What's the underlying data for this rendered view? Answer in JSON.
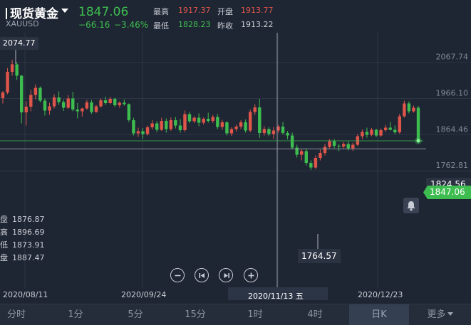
{
  "header": {
    "title": "现货黄金",
    "symbol": "XAUUSD",
    "price": "1847.06",
    "change": "−66.16",
    "change_pct": "−3.46%",
    "stats": {
      "high_label": "最高",
      "high": "1917.37",
      "open_label": "开盘",
      "open": "1913.77",
      "low_label": "最低",
      "low": "1828.23",
      "prev_label": "昨收",
      "prev": "1913.22"
    }
  },
  "chart_data": {
    "type": "candlestick",
    "y_ticks": [
      "2067.74",
      "1966.10",
      "1864.46",
      "1762.81"
    ],
    "x_ticks": [
      "2020/08/11",
      "2020/09/24",
      "2020/12/23"
    ],
    "crosshair_date": "2020/11/13 五",
    "crosshair_value": "1824.56",
    "current_price_tag": "1847.06",
    "max_marker": "2074.77",
    "min_marker": "1764.57",
    "ohlc_panel": [
      {
        "label": "盘",
        "value": "1876.87"
      },
      {
        "label": "高",
        "value": "1896.69"
      },
      {
        "label": "低",
        "value": "1873.91"
      },
      {
        "label": "盘",
        "value": "1887.47"
      }
    ],
    "candles": [
      [
        1967,
        1987,
        1952,
        1983
      ],
      [
        1983,
        2052,
        1978,
        2041
      ],
      [
        2041,
        2075,
        2030,
        2062
      ],
      [
        2062,
        2068,
        2018,
        2030
      ],
      [
        2030,
        2032,
        1896,
        1927
      ],
      [
        1927,
        1958,
        1890,
        1943
      ],
      [
        1943,
        1990,
        1930,
        1976
      ],
      [
        1976,
        2006,
        1964,
        1996
      ],
      [
        1996,
        2000,
        1955,
        1960
      ],
      [
        1960,
        1966,
        1918,
        1932
      ],
      [
        1932,
        1954,
        1920,
        1944
      ],
      [
        1944,
        1978,
        1938,
        1969
      ],
      [
        1969,
        1986,
        1948,
        1956
      ],
      [
        1956,
        1963,
        1931,
        1940
      ],
      [
        1940,
        1975,
        1936,
        1966
      ],
      [
        1966,
        1985,
        1930,
        1935
      ],
      [
        1935,
        1953,
        1910,
        1930
      ],
      [
        1930,
        1940,
        1915,
        1938
      ],
      [
        1938,
        1962,
        1934,
        1955
      ],
      [
        1955,
        1962,
        1923,
        1928
      ],
      [
        1928,
        1948,
        1926,
        1944
      ],
      [
        1944,
        1966,
        1940,
        1961
      ],
      [
        1961,
        1971,
        1948,
        1953
      ],
      [
        1953,
        1970,
        1950,
        1965
      ],
      [
        1965,
        1968,
        1942,
        1947
      ],
      [
        1947,
        1958,
        1940,
        1954
      ],
      [
        1954,
        1963,
        1946,
        1950
      ],
      [
        1950,
        1952,
        1900,
        1905
      ],
      [
        1905,
        1912,
        1862,
        1868
      ],
      [
        1868,
        1884,
        1858,
        1874
      ],
      [
        1874,
        1883,
        1853,
        1866
      ],
      [
        1866,
        1890,
        1862,
        1885
      ],
      [
        1885,
        1905,
        1879,
        1896
      ],
      [
        1896,
        1903,
        1871,
        1878
      ],
      [
        1878,
        1912,
        1875,
        1903
      ],
      [
        1903,
        1910,
        1870,
        1880
      ],
      [
        1880,
        1913,
        1875,
        1905
      ],
      [
        1905,
        1914,
        1882,
        1890
      ],
      [
        1890,
        1908,
        1870,
        1877
      ],
      [
        1877,
        1932,
        1872,
        1922
      ],
      [
        1922,
        1928,
        1897,
        1902
      ],
      [
        1902,
        1916,
        1897,
        1912
      ],
      [
        1912,
        1924,
        1888,
        1898
      ],
      [
        1898,
        1913,
        1893,
        1909
      ],
      [
        1909,
        1926,
        1898,
        1903
      ],
      [
        1903,
        1920,
        1897,
        1914
      ],
      [
        1914,
        1922,
        1880,
        1886
      ],
      [
        1886,
        1906,
        1878,
        1899
      ],
      [
        1899,
        1902,
        1862,
        1868
      ],
      [
        1868,
        1885,
        1861,
        1880
      ],
      [
        1880,
        1893,
        1873,
        1887
      ],
      [
        1887,
        1905,
        1880,
        1899
      ],
      [
        1899,
        1907,
        1870,
        1876
      ],
      [
        1876,
        1935,
        1871,
        1928
      ],
      [
        1928,
        1950,
        1920,
        1941
      ],
      [
        1941,
        1965,
        1855,
        1869
      ],
      [
        1869,
        1888,
        1862,
        1880
      ],
      [
        1880,
        1886,
        1860,
        1866
      ],
      [
        1866,
        1886,
        1852,
        1876
      ],
      [
        1876,
        1892,
        1870,
        1887
      ],
      [
        1887,
        1900,
        1864,
        1869
      ],
      [
        1869,
        1875,
        1851,
        1862
      ],
      [
        1862,
        1870,
        1823,
        1828
      ],
      [
        1828,
        1836,
        1800,
        1808
      ],
      [
        1808,
        1824,
        1792,
        1818
      ],
      [
        1818,
        1826,
        1778,
        1785
      ],
      [
        1785,
        1792,
        1765,
        1772
      ],
      [
        1772,
        1806,
        1768,
        1799
      ],
      [
        1799,
        1822,
        1792,
        1813
      ],
      [
        1813,
        1838,
        1806,
        1830
      ],
      [
        1830,
        1852,
        1826,
        1846
      ],
      [
        1846,
        1852,
        1826,
        1833
      ],
      [
        1833,
        1838,
        1818,
        1831
      ],
      [
        1831,
        1844,
        1826,
        1838
      ],
      [
        1838,
        1846,
        1820,
        1826
      ],
      [
        1826,
        1842,
        1819,
        1836
      ],
      [
        1836,
        1866,
        1832,
        1860
      ],
      [
        1860,
        1879,
        1852,
        1872
      ],
      [
        1872,
        1884,
        1856,
        1864
      ],
      [
        1864,
        1883,
        1860,
        1878
      ],
      [
        1878,
        1881,
        1858,
        1862
      ],
      [
        1862,
        1882,
        1858,
        1877
      ],
      [
        1877,
        1892,
        1872,
        1884
      ],
      [
        1884,
        1900,
        1876,
        1878
      ],
      [
        1878,
        1890,
        1866,
        1871
      ],
      [
        1871,
        1923,
        1867,
        1916
      ],
      [
        1916,
        1960,
        1912,
        1952
      ],
      [
        1952,
        1958,
        1924,
        1930
      ],
      [
        1930,
        1946,
        1926,
        1940
      ],
      [
        1940,
        1945,
        1840,
        1847
      ]
    ]
  },
  "controls": {
    "zoom_out": "minus-icon",
    "first": "skip-back-icon",
    "last": "skip-forward-icon",
    "zoom_in": "plus-icon"
  },
  "tabs": [
    {
      "label": "分时",
      "active": false
    },
    {
      "label": "1分",
      "active": false
    },
    {
      "label": "5分",
      "active": false
    },
    {
      "label": "15分",
      "active": false
    },
    {
      "label": "1时",
      "active": false
    },
    {
      "label": "4时",
      "active": false
    },
    {
      "label": "日K",
      "active": true
    },
    {
      "label": "更多",
      "active": false
    }
  ],
  "colors": {
    "up": "#e0554a",
    "down": "#3dbd4f",
    "background": "#1f2633",
    "grid": "#2d3544"
  }
}
